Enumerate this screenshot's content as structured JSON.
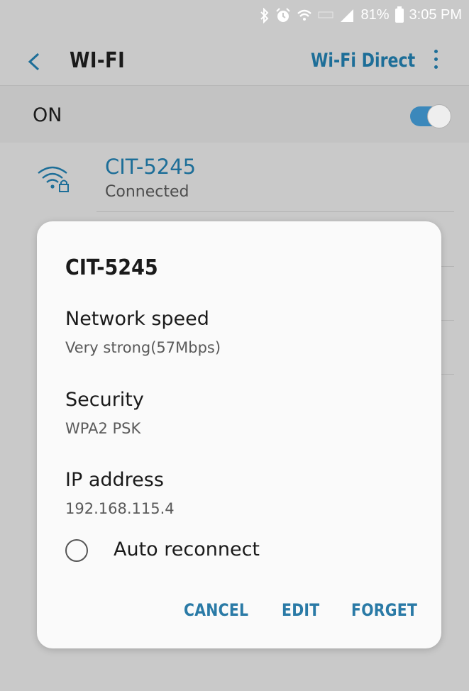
{
  "status_bar": {
    "battery": "81%",
    "time": "3:05 PM",
    "icons": [
      "bluetooth-icon",
      "alarm-icon",
      "wifi-signal-icon",
      "lte-icon",
      "cell-signal-icon",
      "battery-icon"
    ]
  },
  "app_bar": {
    "title": "WI-FI",
    "wifi_direct": "Wi-Fi Direct"
  },
  "master_switch": {
    "label": "ON",
    "state": "on"
  },
  "network": {
    "name": "CIT-5245",
    "status": "Connected"
  },
  "dialog": {
    "title": "CIT-5245",
    "fields": [
      {
        "label": "Network speed",
        "value": "Very strong(57Mbps)"
      },
      {
        "label": "Security",
        "value": "WPA2 PSK"
      },
      {
        "label": "IP address",
        "value": "192.168.115.4"
      }
    ],
    "auto_reconnect": {
      "label": "Auto reconnect",
      "checked": false
    },
    "buttons": {
      "cancel": "CANCEL",
      "edit": "EDIT",
      "forget": "FORGET"
    }
  },
  "colors": {
    "accent": "#1d6e98",
    "toggle_on": "#3b88bb",
    "scrim_background": "#c9c9c9",
    "dialog_background": "#fafafa"
  }
}
